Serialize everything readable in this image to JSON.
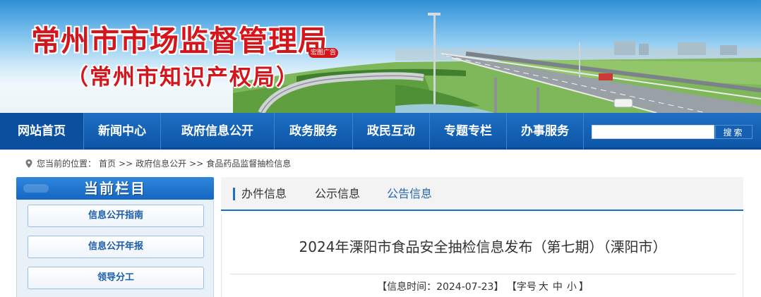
{
  "header": {
    "title": "常州市市场监督管理局",
    "subtitle": "（常州市知识产权局）",
    "seal_text": "宏图广告"
  },
  "nav": {
    "items": [
      {
        "label": "网站首页"
      },
      {
        "label": "新闻中心"
      },
      {
        "label": "政府信息公开"
      },
      {
        "label": "政务服务"
      },
      {
        "label": "政民互动"
      },
      {
        "label": "专题专栏"
      },
      {
        "label": "办事服务"
      }
    ],
    "search_value": "",
    "search_button": "搜索"
  },
  "breadcrumb": {
    "prefix": "您当前的位置：",
    "items": [
      "首页",
      "政府信息公开",
      "食品药品监督抽检信息"
    ],
    "separator": ">>"
  },
  "sidebar": {
    "title": "当前栏目",
    "items": [
      {
        "label": "信息公开指南"
      },
      {
        "label": "信息公开年报"
      },
      {
        "label": "领导分工"
      }
    ]
  },
  "tabs": [
    {
      "label": "办件信息"
    },
    {
      "label": "公示信息"
    },
    {
      "label": "公告信息"
    }
  ],
  "article": {
    "title": "2024年溧阳市食品安全抽检信息发布（第七期）（溧阳市）",
    "meta_open": "【信息时间：",
    "date": "2024-07-23",
    "meta_close": "】",
    "font_open": "【字号",
    "font_large": "大",
    "font_medium": "中",
    "font_small": "小",
    "font_close": "】"
  },
  "colors": {
    "brand_red": "#d4161c",
    "nav_blue": "#0d56a8",
    "accent_blue": "#1e6fc2"
  }
}
